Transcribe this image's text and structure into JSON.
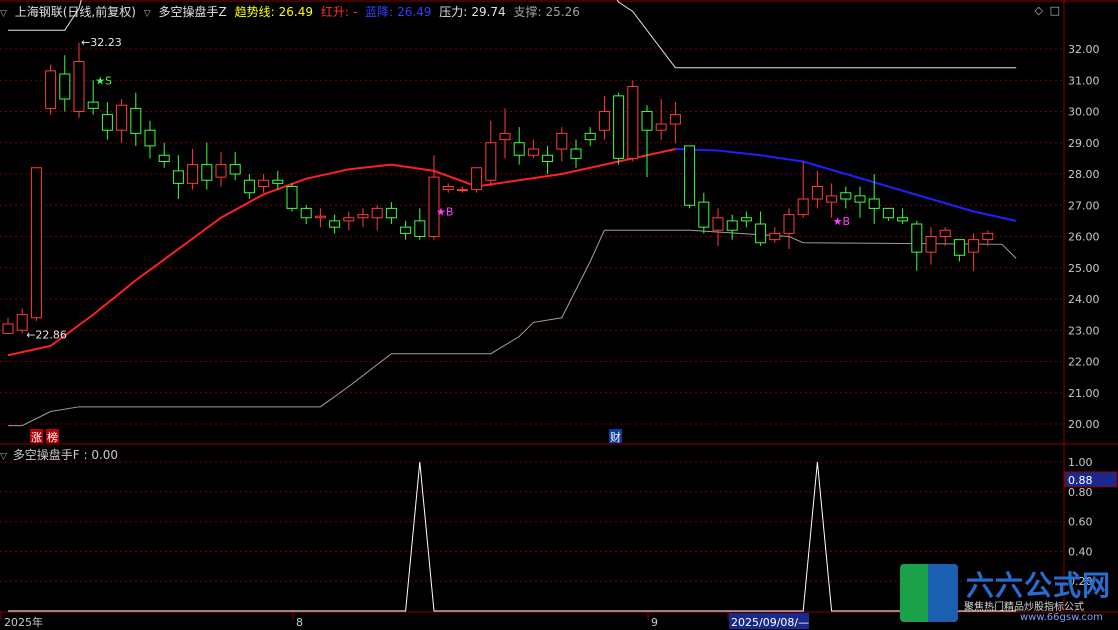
{
  "header": {
    "stock": "上海钢联(日线,前复权)",
    "indicator": "多空操盘手Z",
    "trend_label": "趋势线:",
    "trend_value": "26.49",
    "red_label": "红升:",
    "red_value": "-",
    "blue_label": "蓝降:",
    "blue_value": "26.49",
    "pressure_label": "压力:",
    "pressure_value": "29.74",
    "support_label": "支撑:",
    "support_value": "25.26"
  },
  "sub_header": {
    "indicator": "多空操盘手F",
    "value": ": 0.00"
  },
  "toolbar": {
    "icons": [
      "diamond-icon",
      "square-icon"
    ]
  },
  "logo": {
    "name": "六六公式网",
    "slogan": "聚焦热门精品炒股指标公式",
    "url": "www.66gsw.com"
  },
  "colors": {
    "up": "#ff3b3b",
    "down": "#3cff3c",
    "trend_up": "#ff2020",
    "trend_down": "#2020ff",
    "grid": "#7a0000",
    "axis_text": "#c8c8c8"
  },
  "chart_data": [
    {
      "type": "candlestick",
      "title": "上海钢联(日线,前复权)",
      "ylim": [
        19.6,
        32.5
      ],
      "y_ticks": [
        "32.00",
        "31.00",
        "30.00",
        "29.00",
        "28.00",
        "27.00",
        "26.00",
        "25.00",
        "24.00",
        "23.00",
        "22.00",
        "21.00",
        "20.00"
      ],
      "x_labels": [
        "2025年",
        "8",
        "9",
        "2025/09/08/—"
      ],
      "markers": [
        "涨",
        "榜",
        "财"
      ],
      "annotations": [
        "32.23",
        "22.86",
        "★B",
        "★B",
        "★S"
      ],
      "candles": [
        [
          22.9,
          23.2,
          23.4,
          22.9
        ],
        [
          23.0,
          23.5,
          23.7,
          22.9
        ],
        [
          23.4,
          28.2,
          28.2,
          23.3
        ],
        [
          30.1,
          31.3,
          31.5,
          29.9
        ],
        [
          31.2,
          30.4,
          31.8,
          30.0
        ],
        [
          30.0,
          31.6,
          32.2,
          29.8
        ],
        [
          30.3,
          30.1,
          31.0,
          29.9
        ],
        [
          29.9,
          29.4,
          30.3,
          29.1
        ],
        [
          29.4,
          30.2,
          30.4,
          29.0
        ],
        [
          30.1,
          29.3,
          30.6,
          28.9
        ],
        [
          29.4,
          28.9,
          29.7,
          28.5
        ],
        [
          28.6,
          28.4,
          29.0,
          28.2
        ],
        [
          28.1,
          27.7,
          28.6,
          27.2
        ],
        [
          27.7,
          28.3,
          28.8,
          27.5
        ],
        [
          28.3,
          27.8,
          29.0,
          27.5
        ],
        [
          27.9,
          28.3,
          28.7,
          27.6
        ],
        [
          28.3,
          28.0,
          28.7,
          27.8
        ],
        [
          27.8,
          27.4,
          28.0,
          27.2
        ],
        [
          27.6,
          27.8,
          28.0,
          27.4
        ],
        [
          27.8,
          27.7,
          28.1,
          27.5
        ],
        [
          27.6,
          26.9,
          27.7,
          26.8
        ],
        [
          26.9,
          26.6,
          27.0,
          26.4
        ],
        [
          26.6,
          26.65,
          26.9,
          26.3
        ],
        [
          26.5,
          26.3,
          26.7,
          26.1
        ],
        [
          26.5,
          26.6,
          26.8,
          26.2
        ],
        [
          26.6,
          26.7,
          26.9,
          26.3
        ],
        [
          26.6,
          26.9,
          27.0,
          26.2
        ],
        [
          26.9,
          26.6,
          27.1,
          26.4
        ],
        [
          26.3,
          26.1,
          26.5,
          25.9
        ],
        [
          26.5,
          26.0,
          26.9,
          25.9
        ],
        [
          26.0,
          27.9,
          28.6,
          25.9
        ],
        [
          27.5,
          27.6,
          27.7,
          27.4
        ],
        [
          27.5,
          27.5,
          27.6,
          27.4
        ],
        [
          27.5,
          28.2,
          28.2,
          27.4
        ],
        [
          27.8,
          29.0,
          29.7,
          27.6
        ],
        [
          29.1,
          29.3,
          30.1,
          28.5
        ],
        [
          29.0,
          28.6,
          29.5,
          28.3
        ],
        [
          28.6,
          28.8,
          29.1,
          28.5
        ],
        [
          28.6,
          28.4,
          28.9,
          28.0
        ],
        [
          28.8,
          29.3,
          29.5,
          28.4
        ],
        [
          28.8,
          28.5,
          29.1,
          28.2
        ],
        [
          29.3,
          29.1,
          29.5,
          28.9
        ],
        [
          29.4,
          30.0,
          30.5,
          29.1
        ],
        [
          30.5,
          28.5,
          30.6,
          28.3
        ],
        [
          28.5,
          30.8,
          31.0,
          28.4
        ],
        [
          30.0,
          29.4,
          30.2,
          27.9
        ],
        [
          29.4,
          29.6,
          30.4,
          29.1
        ],
        [
          29.6,
          29.9,
          30.3,
          29.0
        ],
        [
          28.9,
          27.0,
          28.9,
          26.9
        ],
        [
          27.1,
          26.3,
          27.4,
          26.1
        ],
        [
          26.2,
          26.6,
          26.9,
          25.7
        ],
        [
          26.5,
          26.2,
          26.7,
          25.9
        ],
        [
          26.6,
          26.5,
          26.8,
          26.3
        ],
        [
          26.4,
          25.8,
          26.8,
          25.7
        ],
        [
          25.9,
          26.1,
          26.3,
          25.8
        ],
        [
          26.1,
          26.7,
          26.9,
          25.6
        ],
        [
          26.7,
          27.2,
          28.4,
          26.6
        ],
        [
          27.2,
          27.6,
          28.1,
          26.9
        ],
        [
          27.1,
          27.3,
          27.7,
          26.6
        ],
        [
          27.4,
          27.2,
          27.6,
          26.9
        ],
        [
          27.3,
          27.1,
          27.6,
          26.6
        ],
        [
          27.2,
          26.9,
          28.0,
          26.4
        ],
        [
          26.9,
          26.6,
          26.9,
          26.5
        ],
        [
          26.6,
          26.5,
          26.9,
          26.4
        ],
        [
          26.4,
          25.5,
          26.5,
          24.9
        ],
        [
          25.5,
          26.0,
          26.3,
          25.1
        ],
        [
          26.0,
          26.2,
          26.3,
          25.7
        ],
        [
          25.9,
          25.4,
          25.9,
          25.2
        ],
        [
          25.5,
          25.9,
          26.1,
          24.9
        ],
        [
          25.9,
          26.1,
          26.2,
          25.7
        ]
      ],
      "trend_line": [
        [
          0,
          22.2
        ],
        [
          3,
          22.5
        ],
        [
          6,
          23.5
        ],
        [
          9,
          24.6
        ],
        [
          12,
          25.6
        ],
        [
          15,
          26.6
        ],
        [
          18,
          27.35
        ],
        [
          21,
          27.85
        ],
        [
          24,
          28.15
        ],
        [
          27,
          28.3
        ],
        [
          30,
          28.1
        ],
        [
          33,
          27.6
        ],
        [
          36,
          27.8
        ],
        [
          39,
          28.0
        ],
        [
          42,
          28.3
        ],
        [
          45,
          28.6
        ],
        [
          47,
          28.8
        ],
        [
          50,
          28.75
        ],
        [
          53,
          28.6
        ],
        [
          56,
          28.4
        ],
        [
          59,
          28.0
        ],
        [
          62,
          27.6
        ],
        [
          65,
          27.2
        ],
        [
          68,
          26.8
        ],
        [
          71,
          26.5
        ]
      ],
      "trend_up_until": 47,
      "pressure_line": [
        [
          0,
          32.6
        ],
        [
          4,
          32.6
        ],
        [
          5,
          33.3
        ],
        [
          6,
          35.0
        ],
        [
          7,
          35.4
        ],
        [
          40,
          35.4
        ],
        [
          41,
          34.9
        ],
        [
          43,
          33.5
        ],
        [
          44,
          33.2
        ],
        [
          47,
          31.4
        ],
        [
          71,
          31.4
        ]
      ],
      "support_line": [
        [
          0,
          19.95
        ],
        [
          1,
          19.95
        ],
        [
          3,
          20.4
        ],
        [
          5,
          20.55
        ],
        [
          20,
          20.55
        ],
        [
          22,
          20.55
        ],
        [
          24,
          21.2
        ],
        [
          27,
          22.25
        ],
        [
          29,
          22.25
        ],
        [
          34,
          22.25
        ],
        [
          36,
          22.8
        ],
        [
          37,
          23.25
        ],
        [
          39,
          23.4
        ],
        [
          41,
          25.2
        ],
        [
          42,
          26.2
        ],
        [
          48,
          26.2
        ],
        [
          55,
          26.0
        ],
        [
          56,
          25.8
        ],
        [
          70,
          25.75
        ],
        [
          71,
          25.3
        ]
      ]
    },
    {
      "type": "line",
      "title": "多空操盘手F",
      "ylim": [
        0.0,
        1.0
      ],
      "y_ticks": [
        "1.00",
        "0.88",
        "0.80",
        "0.60",
        "0.40",
        "0.20"
      ],
      "current_value": "0.88",
      "values": [
        0,
        0,
        0,
        0,
        0,
        0,
        0,
        0,
        0,
        0,
        0,
        0,
        0,
        0,
        0,
        0,
        0,
        0,
        0,
        0,
        0,
        0,
        0,
        0,
        0,
        0,
        0,
        0,
        0,
        1,
        0,
        0,
        0,
        0,
        0,
        0,
        0,
        0,
        0,
        0,
        0,
        0,
        0,
        0,
        0,
        0,
        0,
        0,
        0,
        0,
        0,
        0,
        0,
        0,
        0,
        0,
        0,
        1,
        0,
        0,
        0,
        0,
        0,
        0,
        0,
        0,
        0,
        0,
        0,
        0,
        0,
        0
      ]
    }
  ]
}
